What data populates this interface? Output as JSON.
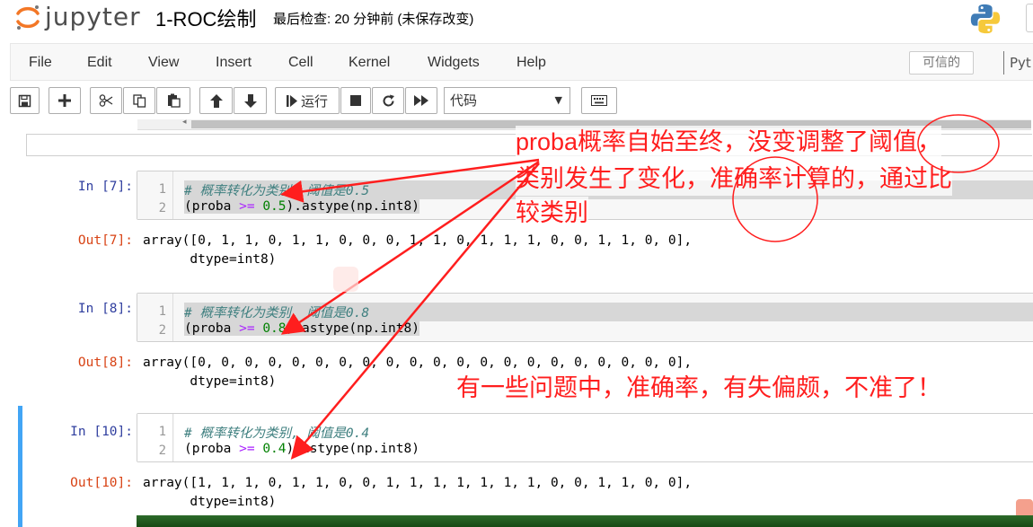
{
  "header": {
    "logo_text": "jupyter",
    "notebook_name": "1-ROC绘制",
    "save_status": "最后检查: 20 分钟前  (未保存改变)"
  },
  "menubar": {
    "items": [
      "File",
      "Edit",
      "View",
      "Insert",
      "Cell",
      "Kernel",
      "Widgets",
      "Help"
    ],
    "trusted": "可信的",
    "kernel": "Pyt"
  },
  "toolbar": {
    "run_label": "运行",
    "cell_type": "代码"
  },
  "cells": [
    {
      "in_prompt": "In  [7]:",
      "lines": [
        "1",
        "2"
      ],
      "comment": "# 概率转化为类别, 阈值是0.5",
      "code": {
        "pre": "(proba ",
        "op": ">=",
        "sp": " ",
        "num": "0.5",
        "post": ").astype(np.int8)"
      },
      "out_prompt": "Out[7]:",
      "output_line1": "array([0, 1, 1, 0, 1, 1, 0, 0, 0, 1, 1, 0, 1, 1, 1, 0, 0, 1, 1, 0, 0],",
      "output_line2": "      dtype=int8)"
    },
    {
      "in_prompt": "In  [8]:",
      "lines": [
        "1",
        "2"
      ],
      "comment": "# 概率转化为类别, 阈值是0.8",
      "code": {
        "pre": "(proba ",
        "op": ">=",
        "sp": " ",
        "num": "0.8",
        "post": ").astype(np.int8)"
      },
      "out_prompt": "Out[8]:",
      "output_line1": "array([0, 0, 0, 0, 0, 0, 0, 0, 0, 0, 0, 0, 0, 0, 0, 0, 0, 0, 0, 0, 0],",
      "output_line2": "      dtype=int8)"
    },
    {
      "in_prompt": "In  [10]:",
      "lines": [
        "1",
        "2"
      ],
      "comment": "# 概率转化为类别, 阈值是0.4",
      "code": {
        "pre": "(proba ",
        "op": ">=",
        "sp": " ",
        "num": "0.4",
        "post": ").astype(np.int8)"
      },
      "out_prompt": "Out[10]:",
      "output_line1": "array([1, 1, 1, 0, 1, 1, 0, 0, 1, 1, 1, 1, 1, 1, 1, 0, 0, 1, 1, 0, 0],",
      "output_line2": "      dtype=int8)"
    }
  ],
  "annotations": {
    "line1": "proba概率自始至终，没变调整了阈值，",
    "line2": "类别发生了变化，准确率计算的，通过比",
    "line3": "较类别",
    "note": "有一些问题中，准确率，有失偏颇，不准了！",
    "color": "#ff1e1e"
  },
  "colors": {
    "prompt_in": "#303f9f",
    "prompt_out": "#d84315",
    "selected_cell_bar": "#42a5f5",
    "comment": "#408080",
    "operator": "#aa22ff",
    "number": "#008000"
  }
}
